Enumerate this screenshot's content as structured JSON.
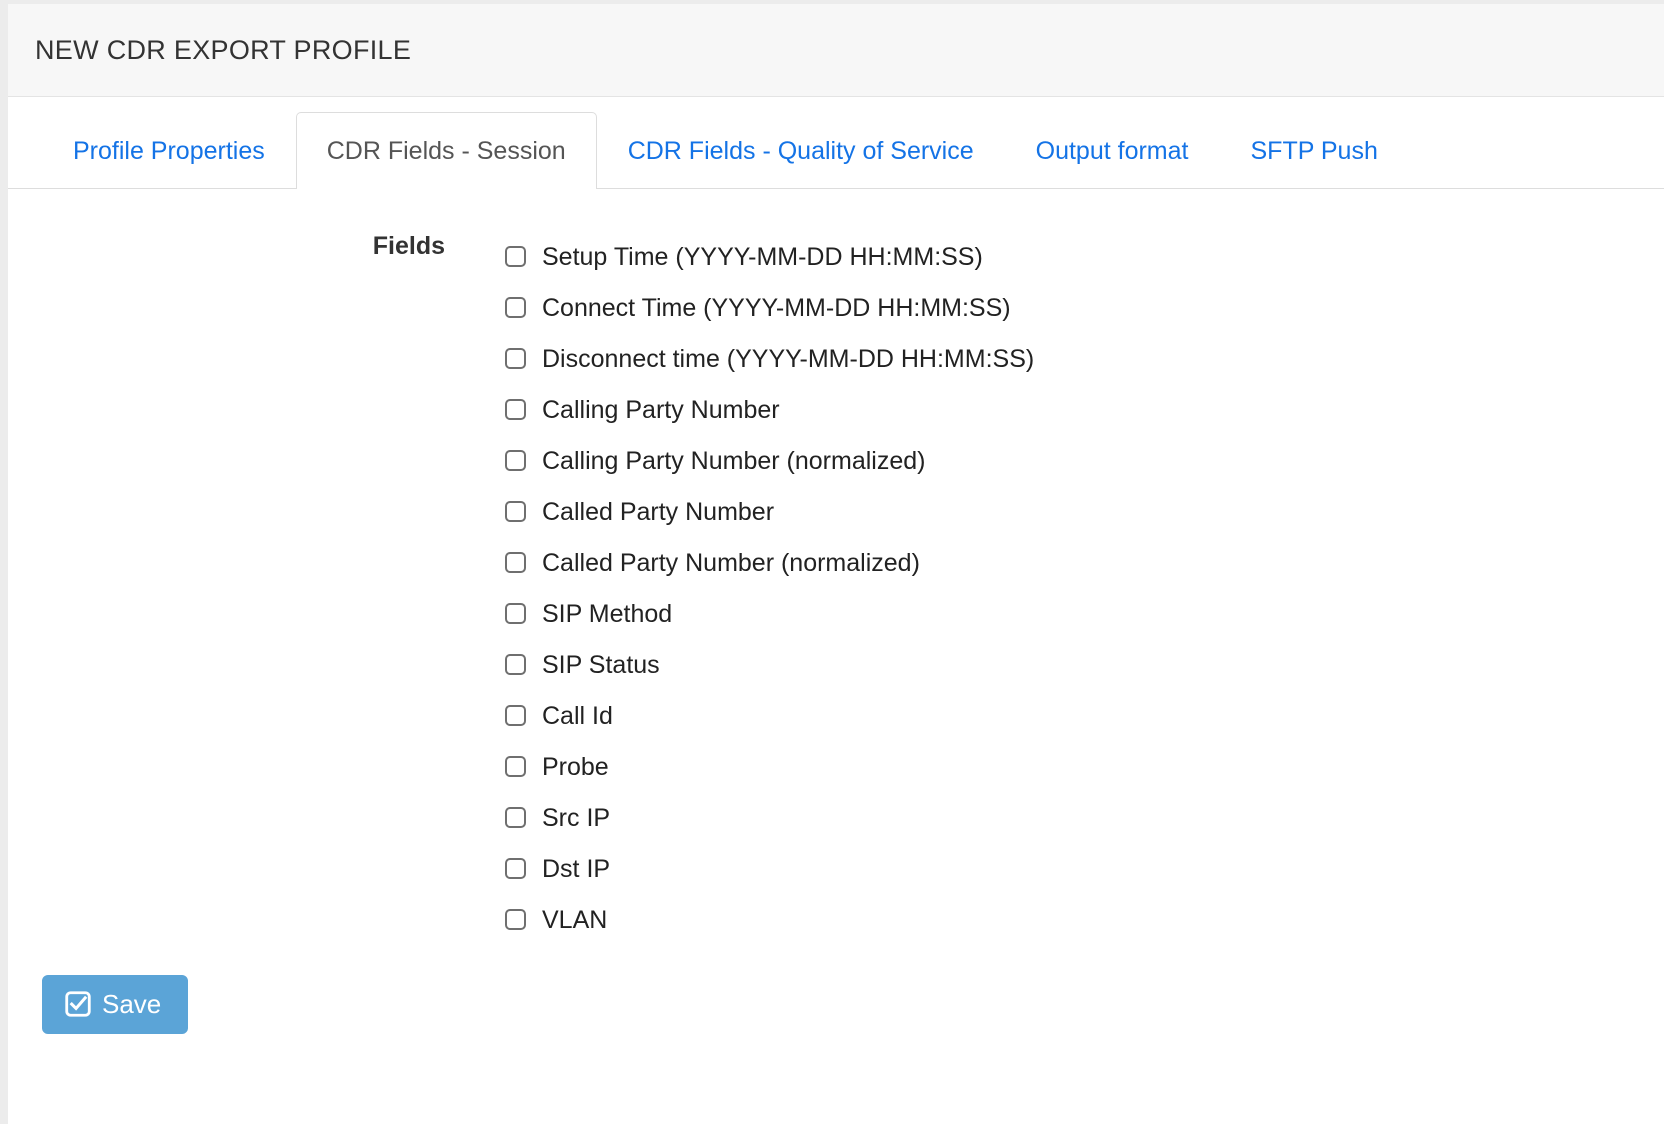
{
  "header": {
    "title": "NEW CDR EXPORT PROFILE"
  },
  "tabs": [
    {
      "label": "Profile Properties",
      "active": false,
      "name": "tab-profile-properties"
    },
    {
      "label": "CDR Fields - Session",
      "active": true,
      "name": "tab-cdr-fields-session"
    },
    {
      "label": "CDR Fields - Quality of Service",
      "active": false,
      "name": "tab-cdr-fields-quality-of-service"
    },
    {
      "label": "Output format",
      "active": false,
      "name": "tab-output-format"
    },
    {
      "label": "SFTP Push",
      "active": false,
      "name": "tab-sftp-push"
    }
  ],
  "form": {
    "fields_label": "Fields",
    "checkboxes": [
      {
        "label": "Setup Time (YYYY-MM-DD HH:MM:SS)",
        "checked": false
      },
      {
        "label": "Connect Time (YYYY-MM-DD HH:MM:SS)",
        "checked": false
      },
      {
        "label": "Disconnect time (YYYY-MM-DD HH:MM:SS)",
        "checked": false
      },
      {
        "label": "Calling Party Number",
        "checked": false
      },
      {
        "label": "Calling Party Number (normalized)",
        "checked": false
      },
      {
        "label": "Called Party Number",
        "checked": false
      },
      {
        "label": "Called Party Number (normalized)",
        "checked": false
      },
      {
        "label": "SIP Method",
        "checked": false
      },
      {
        "label": "SIP Status",
        "checked": false
      },
      {
        "label": "Call Id",
        "checked": false
      },
      {
        "label": "Probe",
        "checked": false
      },
      {
        "label": "Src IP",
        "checked": false
      },
      {
        "label": "Dst IP",
        "checked": false
      },
      {
        "label": "VLAN",
        "checked": false
      }
    ]
  },
  "actions": {
    "save_label": "Save",
    "save_icon": "check-square-icon"
  },
  "colors": {
    "accent_blue": "#1473e6",
    "button_blue": "#5ba4d7",
    "header_bg": "#f7f7f7",
    "border_gray": "#dddddd",
    "text_dark": "#333333"
  }
}
